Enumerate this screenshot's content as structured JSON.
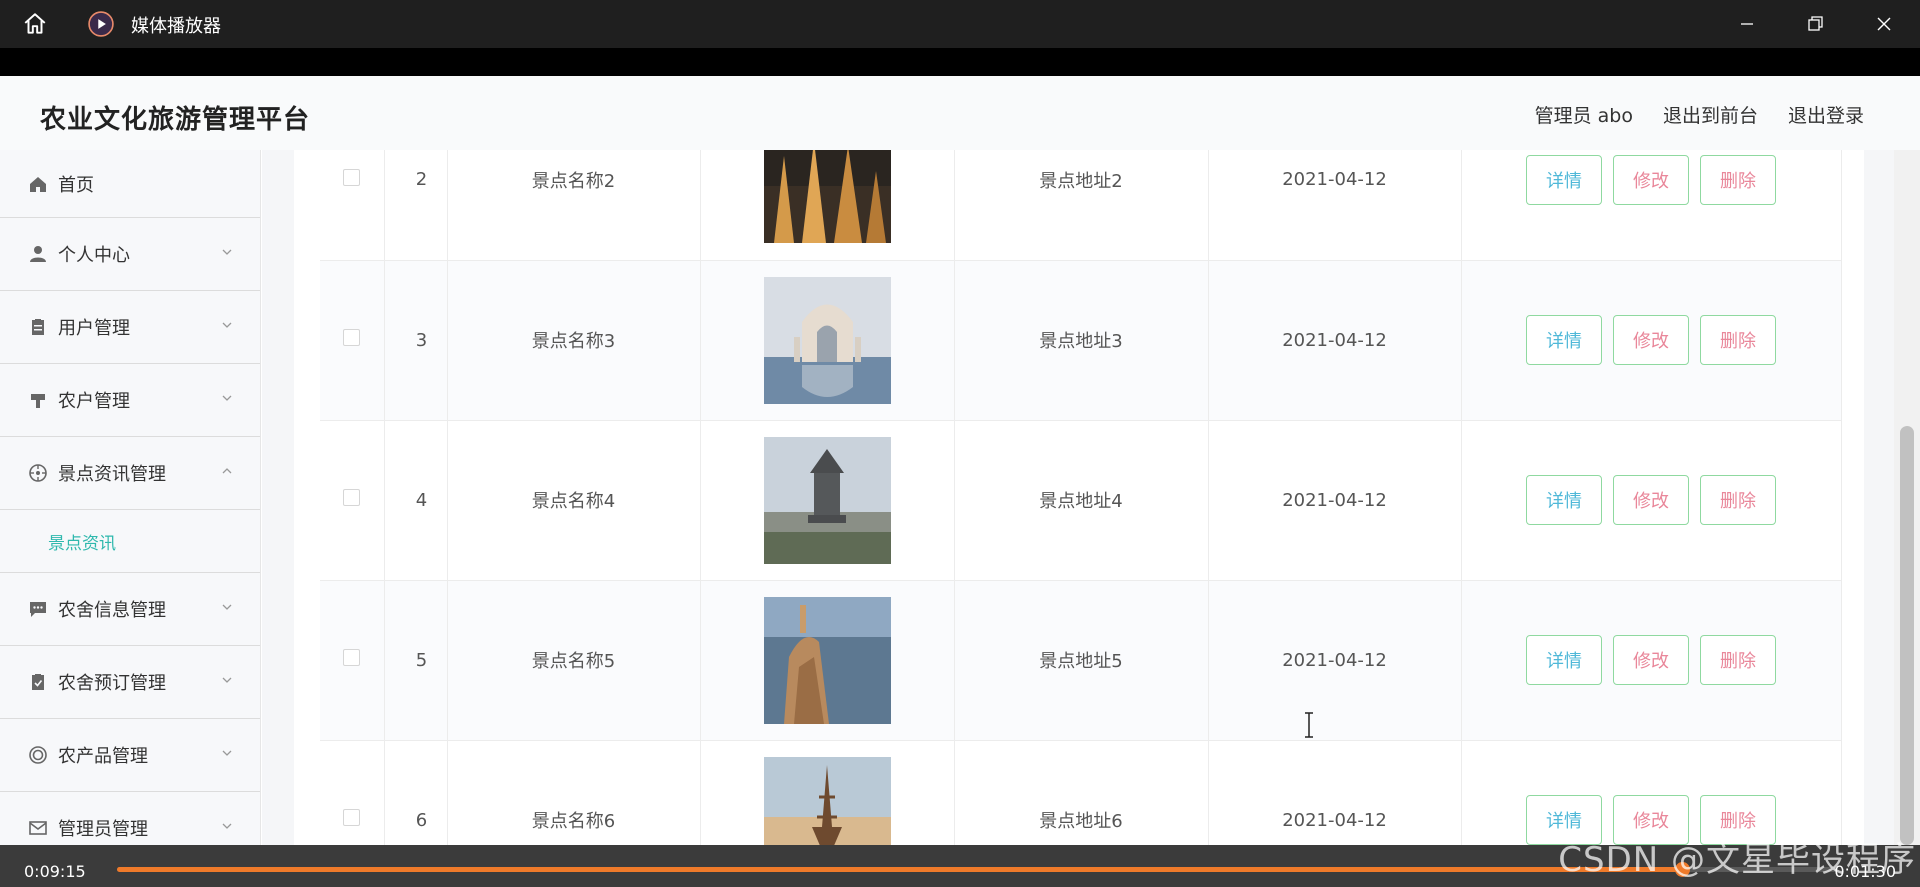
{
  "player": {
    "title": "媒体播放器",
    "current_time": "0:09:15",
    "total_time": "0:01:30",
    "progress": 0.91
  },
  "site": {
    "title": "农业文化旅游管理平台",
    "header_links": [
      "管理员 abo",
      "退出到前台",
      "退出登录"
    ]
  },
  "sidebar": {
    "items": [
      {
        "label": "首页",
        "icon": "home-icon"
      },
      {
        "label": "个人中心",
        "icon": "person-icon"
      },
      {
        "label": "用户管理",
        "icon": "clipboard-icon"
      },
      {
        "label": "农户管理",
        "icon": "brush-icon"
      },
      {
        "label": "景点资讯管理",
        "icon": "compass-icon"
      },
      {
        "label": "农舍信息管理",
        "icon": "chat-icon"
      },
      {
        "label": "农舍预订管理",
        "icon": "checklist-icon"
      },
      {
        "label": "农产品管理",
        "icon": "circle-icon"
      },
      {
        "label": "管理员管理",
        "icon": "mail-icon"
      }
    ],
    "submenu": {
      "label": "景点资讯"
    }
  },
  "table": {
    "rows": [
      {
        "index": "2",
        "name": "景点名称2",
        "address": "景点地址2",
        "date": "2021-04-12"
      },
      {
        "index": "3",
        "name": "景点名称3",
        "address": "景点地址3",
        "date": "2021-04-12"
      },
      {
        "index": "4",
        "name": "景点名称4",
        "address": "景点地址4",
        "date": "2021-04-12"
      },
      {
        "index": "5",
        "name": "景点名称5",
        "address": "景点地址5",
        "date": "2021-04-12"
      },
      {
        "index": "6",
        "name": "景点名称6",
        "address": "景点地址6",
        "date": "2021-04-12"
      }
    ],
    "actions": {
      "detail": "详情",
      "edit": "修改",
      "delete": "删除"
    }
  },
  "watermark": "CSDN @文星毕设程序",
  "colors": {
    "accent": "#2fb8ad",
    "button_border": "#8fd9a0",
    "detail_text": "#4fb8d8",
    "edit_delete_text": "#e9879a",
    "progress": "#ef7a2a"
  }
}
